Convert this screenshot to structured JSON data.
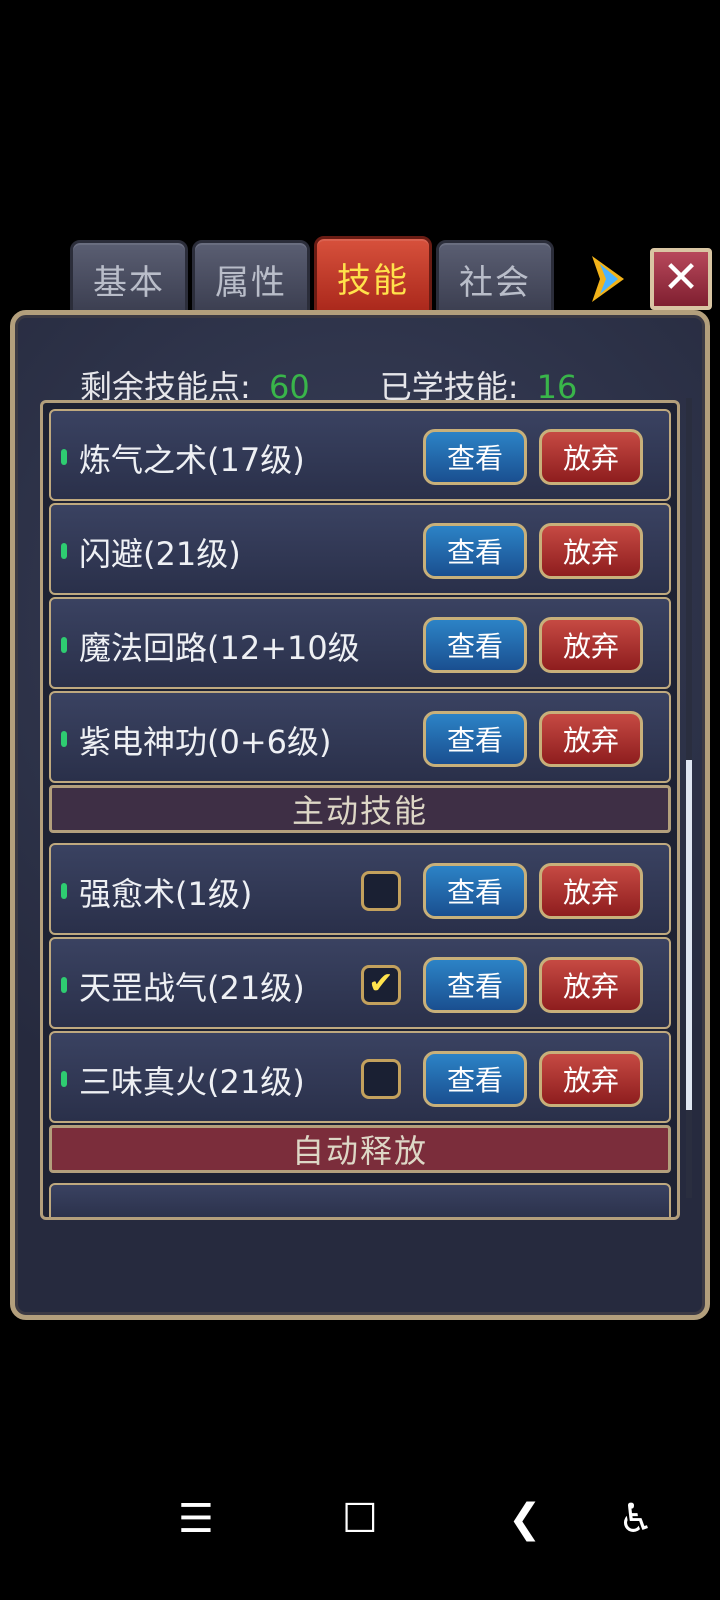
{
  "tabs": [
    "基本",
    "属性",
    "技能",
    "社会"
  ],
  "active_tab": "技能",
  "stats": {
    "remaining_label": "剩余技能点:",
    "remaining_value": "60",
    "learned_label": "已学技能:",
    "learned_value": "16"
  },
  "buttons": {
    "view": "查看",
    "drop": "放弃"
  },
  "skills_passive": [
    {
      "name": "炼气之术(17级)"
    },
    {
      "name": "闪避(21级)"
    },
    {
      "name": "魔法回路(12+10级"
    },
    {
      "name": "紫电神功(0+6级)"
    }
  ],
  "section_active": "主动技能",
  "skills_active": [
    {
      "name": "强愈术(1级)",
      "checked": false
    },
    {
      "name": "天罡战气(21级)",
      "checked": true
    },
    {
      "name": "三味真火(21级)",
      "checked": false
    }
  ],
  "section_auto": "自动释放",
  "navbar": {
    "menu_icon": "menu-icon",
    "home_icon": "home-icon",
    "back_icon": "back-icon",
    "accessibility_icon": "accessibility-icon"
  }
}
